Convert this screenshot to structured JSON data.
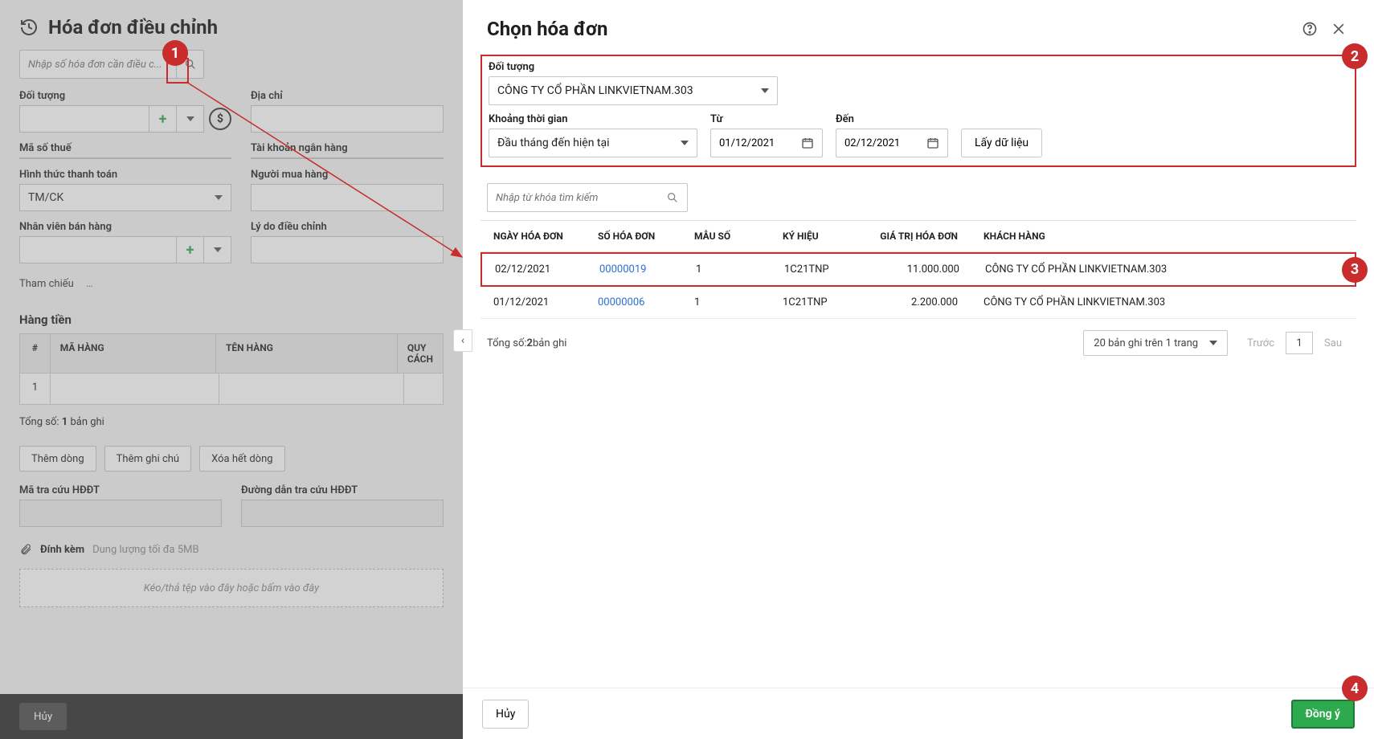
{
  "bg": {
    "title": "Hóa đơn điều chỉnh",
    "search_placeholder": "Nhập số hóa đơn cần điều c...",
    "labels": {
      "doituong": "Đối tượng",
      "diachi": "Địa chỉ",
      "mst": "Mã số thuế",
      "tknh": "Tài khoản ngân hàng",
      "httt": "Hình thức thanh toán",
      "nmh": "Người mua hàng",
      "nvbh": "Nhân viên bán hàng",
      "lydodc": "Lý do điều chỉnh"
    },
    "payment_method": "TM/CK",
    "ref_label": "Tham chiếu",
    "ref_dots": "…",
    "items_section": "Hàng tiền",
    "columns": {
      "idx": "#",
      "mahang": "MÃ HÀNG",
      "tenhang": "TÊN HÀNG",
      "quycach": "QUY CÁCH"
    },
    "row1_idx": "1",
    "total_prefix": "Tổng số: ",
    "total_count": "1",
    "total_suffix": " bản ghi",
    "actions": {
      "add_row": "Thêm dòng",
      "add_note": "Thêm ghi chú",
      "clear_rows": "Xóa hết dòng"
    },
    "lookup_code": "Mã tra cứu HĐĐT",
    "lookup_url": "Đường dẫn tra cứu HĐĐT",
    "attach_label": "Đính kèm",
    "attach_hint": "Dung lượng tối đa 5MB",
    "drop_hint": "Kéo/thả tệp vào đây hoặc bấm vào đây",
    "cancel": "Hủy"
  },
  "modal": {
    "title": "Chọn hóa đơn",
    "labels": {
      "doituong": "Đối tượng",
      "khoangtg": "Khoảng thời gian",
      "tu": "Từ",
      "den": "Đến"
    },
    "doituong_value": "CÔNG TY CỔ PHẦN LINKVIETNAM.303",
    "period_value": "Đầu tháng đến hiện tại",
    "from_date": "01/12/2021",
    "to_date": "02/12/2021",
    "fetch_btn": "Lấy dữ liệu",
    "search_placeholder": "Nhập từ khóa tìm kiếm",
    "columns": {
      "date": "NGÀY HÓA ĐƠN",
      "inv": "SỐ HÓA ĐƠN",
      "ms": "MẪU SỐ",
      "kh": "KÝ HIỆU",
      "val": "GIÁ TRỊ HÓA ĐƠN",
      "cust": "KHÁCH HÀNG"
    },
    "rows": [
      {
        "date": "02/12/2021",
        "inv": "00000019",
        "ms": "1",
        "kh": "1C21TNP",
        "val": "11.000.000",
        "cust": "CÔNG TY CỔ PHẦN LINKVIETNAM.303"
      },
      {
        "date": "01/12/2021",
        "inv": "00000006",
        "ms": "1",
        "kh": "1C21TNP",
        "val": "2.200.000",
        "cust": "CÔNG TY CỔ PHẦN LINKVIETNAM.303"
      }
    ],
    "pager": {
      "total_prefix": "Tổng số: ",
      "total_count": "2",
      "total_suffix": " bản ghi",
      "pagesize": "20 bản ghi trên 1 trang",
      "prev": "Trước",
      "page": "1",
      "next": "Sau"
    },
    "cancel": "Hủy",
    "confirm": "Đồng ý"
  },
  "steps": {
    "s1": "1",
    "s2": "2",
    "s3": "3",
    "s4": "4"
  }
}
